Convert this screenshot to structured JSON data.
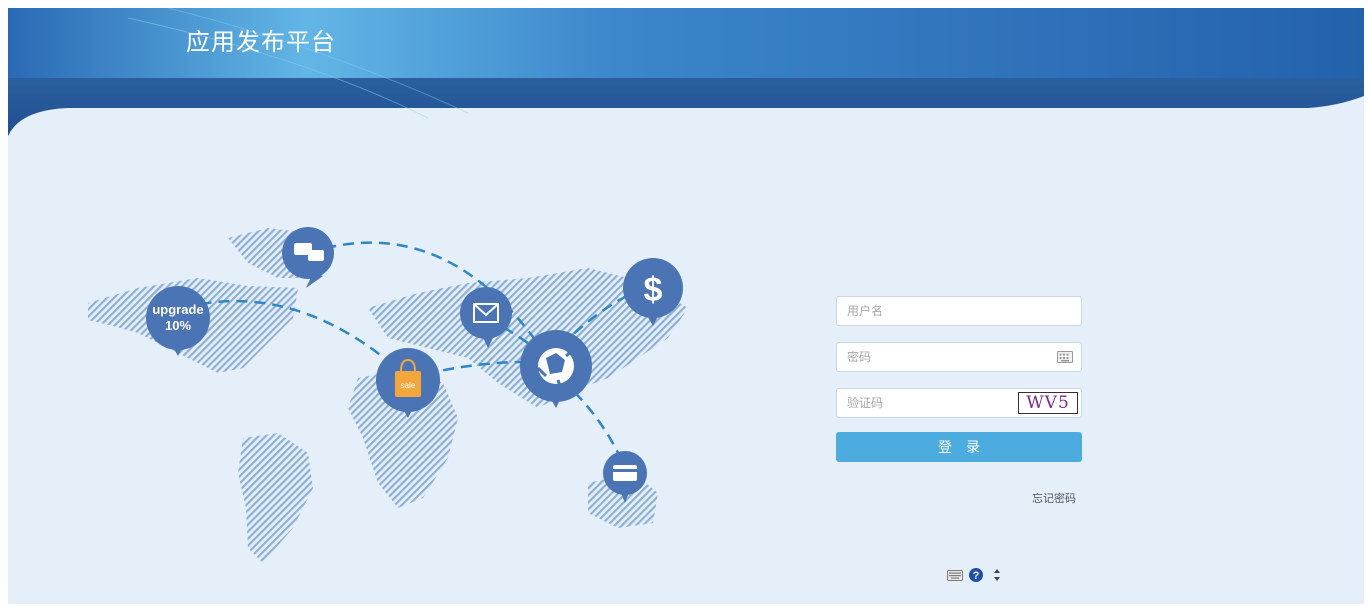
{
  "header": {
    "title": "应用发布平台"
  },
  "map": {
    "bubbles": {
      "upgrade": {
        "line1": "upgrade",
        "line2": "10%"
      },
      "dollar": "$",
      "bag_tag": "sale"
    },
    "colors": {
      "bubble": "#4a74b4",
      "dash": "#2f86c6",
      "land": "#8fb0d6"
    }
  },
  "login": {
    "username_placeholder": "用户名",
    "password_placeholder": "密码",
    "captcha_placeholder": "验证码",
    "captcha_code": "WV5",
    "login_label": "登录",
    "forgot_password": "忘记密码"
  },
  "tray": {
    "icons": [
      "keyboard-icon",
      "help-icon",
      "arrows-icon"
    ]
  },
  "colors": {
    "header_dark": "#1f5aa5",
    "header_light": "#5aaee3",
    "background": "#e4eff9",
    "button": "#4dacdf"
  }
}
